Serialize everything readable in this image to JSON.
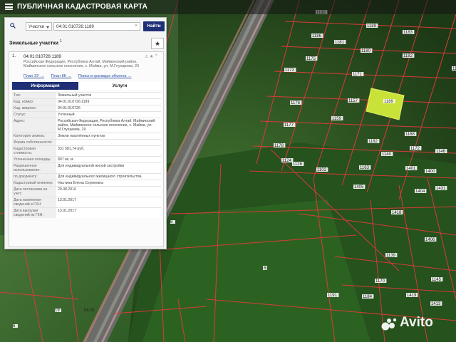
{
  "header": {
    "title": "ПУБЛИЧНАЯ КАДАСТРОВАЯ КАРТА"
  },
  "search": {
    "type_label": "Участки",
    "query": "04:01:010726:1189",
    "find_label": "Найти"
  },
  "results": {
    "title": "Земельные участки",
    "count": "1",
    "item": {
      "index": "1.",
      "number": "04:01:010726:1189",
      "address": "Российская Федерация, Республика Алтай, Майминский район, Майминское сельское поселение, с. Майма, ул. М.Глухарева, 29",
      "links": [
        "План ЗУ →",
        "План КК →",
        "Поиск в границах объекта →"
      ],
      "tabs": [
        "Информация",
        "Услуги"
      ],
      "rows": [
        {
          "k": "Тип:",
          "v": "Земельный участок"
        },
        {
          "k": "Кад. номер:",
          "v": "04:01:010726:1189"
        },
        {
          "k": "Кад. квартал:",
          "v": "04:01:010726"
        },
        {
          "k": "Статус:",
          "v": "Учтенный"
        },
        {
          "k": "Адрес:",
          "v": "Российская Федерация, Республика Алтай, Майминский район, Майминское сельское поселение, с. Майма, ул. М.Глухарева, 29"
        },
        {
          "k": "Категория земель:",
          "v": "Земли населённых пунктов"
        },
        {
          "k": "Форма собственности:",
          "v": ""
        },
        {
          "k": "Кадастровая стоимость:",
          "v": "331 581,74 руб."
        },
        {
          "k": "Уточненная площадь:",
          "v": "807 кв. м"
        },
        {
          "k": "Разрешенное использование:",
          "v": "Для индивидуальной жилой застройки"
        },
        {
          "k": "по документу:",
          "v": "Для индивидуального жилищного строительства"
        },
        {
          "k": "Кадастровый инженер:",
          "v": "Настина Елена Сергеевна"
        },
        {
          "k": "Дата постановки на учет:",
          "v": "29.08.2016"
        },
        {
          "k": "Дата изменения сведений в ГКН:",
          "v": "13.01.2017"
        },
        {
          "k": "Дата выгрузки сведений из ГКН:",
          "v": "13.01.2017"
        }
      ]
    }
  },
  "map": {
    "labels": [
      "1192",
      "1189",
      "1186",
      "1183",
      "1180",
      "1181",
      "1175",
      "1172",
      "1171",
      "1182",
      "1176",
      "1189",
      "1177",
      "1157",
      "1158",
      "1178",
      "1159",
      "1182",
      "1124",
      "1168",
      "1126",
      "1172",
      "1102",
      "1163",
      "1140",
      "1146",
      "1400",
      "1401",
      "1404",
      "1405",
      "1431",
      "1418",
      "1406",
      "1139",
      "1170",
      "1145",
      "1419",
      "1184",
      "1191",
      "1413",
      "6",
      "6",
      "19",
      "19",
      "6",
      "04:01"
    ],
    "highlight_color": "#c9e23a"
  },
  "watermark": {
    "brand": "Avito"
  }
}
